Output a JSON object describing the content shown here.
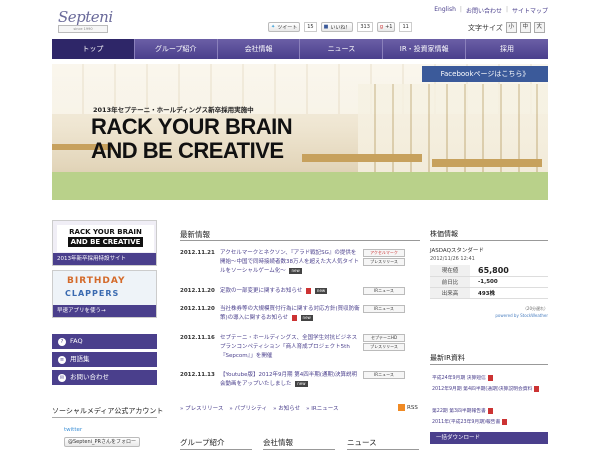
{
  "header": {
    "logo_text": "Septeni",
    "logo_tag": "since 1990",
    "toplinks": [
      "English",
      "お問い合わせ",
      "サイトマップ"
    ],
    "social": [
      {
        "label": "ツイート",
        "count": "15"
      },
      {
        "label": "いいね！",
        "count": "313"
      },
      {
        "label": "+1",
        "count": "11"
      }
    ],
    "fontsize_label": "文字サイズ",
    "fontsize_options": [
      "小",
      "中",
      "大"
    ]
  },
  "nav": {
    "items": [
      "トップ",
      "グループ紹介",
      "会社情報",
      "ニュース",
      "IR・投資家情報",
      "採用"
    ]
  },
  "hero": {
    "subtitle": "2013年セプテーニ・ホールディングス新卒採用実施中",
    "title_line1": "RACK YOUR BRAIN",
    "title_line2": "AND BE CREATIVE",
    "facebook_banner": "Facebookページはこちら》"
  },
  "left": {
    "rack_banner": {
      "line1": "RACK YOUR BRAIN",
      "line2": "AND BE CREATIVE",
      "caption": "2013年新卒採用特設サイト"
    },
    "bday_banner": {
      "line1": "BIRTHDAY",
      "line2": "CLAPPERS",
      "caption": "早速アプリを使う→"
    },
    "buttons": [
      "FAQ",
      "用語集",
      "お問い合わせ"
    ],
    "social_title": "ソーシャルメディア公式アカウント",
    "twitter_label": "twitter",
    "twitter_follow": "@Septeni_PRさんをフォロー"
  },
  "news": {
    "title": "最新情報",
    "items": [
      {
        "date": "2012.11.21",
        "text": "アクセルマークとネクソン、『アラド戦記SG』の提供を開始～中国で同時接続者数38万人を超えた大人気タイトルをソーシャルゲーム化～",
        "tags": [
          "アクセルマーク",
          "プレスリリース"
        ],
        "new": "new",
        "pdf": false
      },
      {
        "date": "2012.11.20",
        "text": "定款の一部変更に関するお知らせ",
        "tags": [
          "IRニュース"
        ],
        "new": "new",
        "pdf": true
      },
      {
        "date": "2012.11.20",
        "text": "当社株券等の大規模買付行為に関する対応方針(買収防衛策)の導入に関するお知らせ",
        "tags": [
          "IRニュース"
        ],
        "new": "new",
        "pdf": true
      },
      {
        "date": "2012.11.16",
        "text": "セプテーニ・ホールディングス、全国学生対抗ビジネスプランコンペティション「商人育成プロジェクト5th『Sepcom』」を開催",
        "tags": [
          "セプテーニHD",
          "プレスリリース"
        ],
        "new": "",
        "pdf": false
      },
      {
        "date": "2012.11.13",
        "text": "【Youtube版】2012年9月期 第4四半期(通期)決算説明会動画をアップいたしました",
        "tags": [
          "IRニュース"
        ],
        "new": "new",
        "pdf": false
      }
    ],
    "links": [
      "プレスリリース",
      "パブリシティ",
      "お知らせ",
      "IRニュース"
    ],
    "rss": "RSS"
  },
  "bottom": {
    "heads": [
      "グループ紹介",
      "会社情報",
      "ニュース"
    ]
  },
  "stock": {
    "title": "株価情報",
    "market": "JASDAQスタンダード",
    "datetime": "2012/11/26 12:41",
    "rows": [
      {
        "label": "現在値",
        "value": "65,800"
      },
      {
        "label": "前日比",
        "value": "-1,500"
      },
      {
        "label": "出来高",
        "value": "493株"
      }
    ],
    "note": "（20分遅れ）",
    "powered": "powered by StockWeather"
  },
  "ir": {
    "title": "最新IR資料",
    "items": [
      "平成24年9月期 決算短信",
      "2012年9月期 第4四半期(通期)決算説明会資料",
      "第22期 第3四半期報告書",
      "2011年(平成23年9月期)報告書"
    ],
    "download": "一括ダウンロード"
  }
}
